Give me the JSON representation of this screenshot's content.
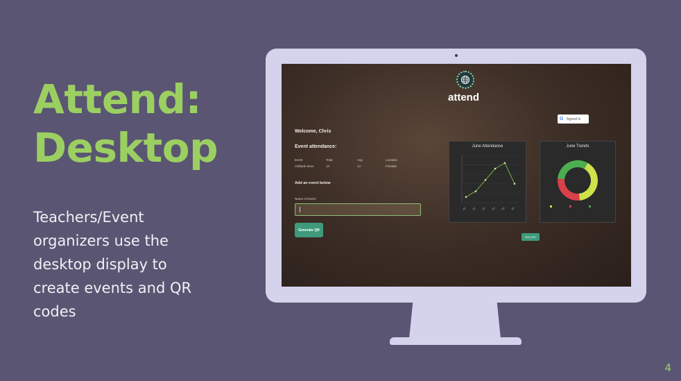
{
  "slide": {
    "title_line1": "Attend:",
    "title_line2": "Desktop",
    "body": "Teachers/Event organizers use the desktop display to create events and QR codes",
    "page_number": "4"
  },
  "app": {
    "name": "attend",
    "signin_label": "Signed in",
    "welcome": "Welcome, Chris",
    "attendance_heading": "Event attendance:",
    "table": {
      "headers": [
        "Event",
        "Total",
        "Avg",
        "Location"
      ],
      "rows": [
        [
          "Citibank Mom",
          "14",
          "14",
          "Fireside"
        ]
      ]
    },
    "add_heading": "Add an event below",
    "field_label": "Name of Event:",
    "generate_label": "Generate QR",
    "csv_label": "Get CSV"
  },
  "colors": {
    "background": "#5a5572",
    "accent_green": "#9ccf62",
    "button_teal": "#3f9a7c"
  },
  "chart_data": [
    {
      "type": "line",
      "title": "June Attendance",
      "x": [
        "6/1",
        "6/2",
        "6/3",
        "6/4",
        "6/5",
        "6/6"
      ],
      "values": [
        3,
        6,
        12,
        18,
        21,
        10
      ],
      "ylim": [
        0,
        25
      ]
    },
    {
      "type": "pie",
      "title": "June Trends",
      "values": [
        40,
        28,
        32
      ],
      "colors": [
        "#cfe24a",
        "#d8404a",
        "#4cae4f"
      ],
      "legend_position": "bottom"
    }
  ]
}
